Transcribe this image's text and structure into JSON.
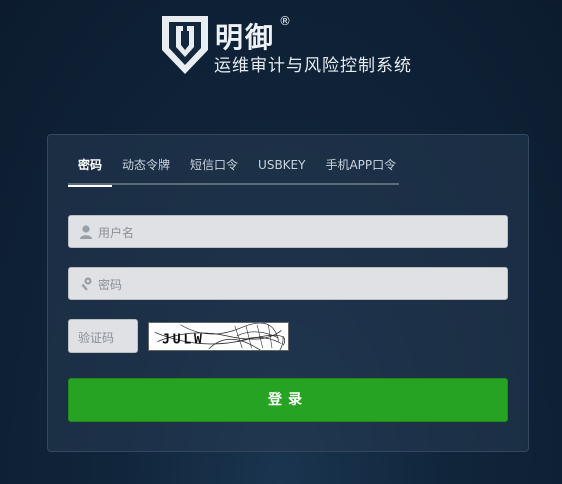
{
  "brand": {
    "name": "明御",
    "registered": "®",
    "subtitle": "运维审计与风险控制系统"
  },
  "tabs": [
    {
      "label": "密码",
      "active": true
    },
    {
      "label": "动态令牌",
      "active": false
    },
    {
      "label": "短信口令",
      "active": false
    },
    {
      "label": "USBKEY",
      "active": false
    },
    {
      "label": "手机APP口令",
      "active": false
    }
  ],
  "form": {
    "username_placeholder": "用户名",
    "password_placeholder": "密码",
    "captcha_placeholder": "验证码",
    "captcha_text": "JULW",
    "login_label": "登录"
  },
  "colors": {
    "accent": "#26a322",
    "background": "#10243a"
  },
  "icons": {
    "username": "user-icon",
    "password": "key-icon"
  }
}
